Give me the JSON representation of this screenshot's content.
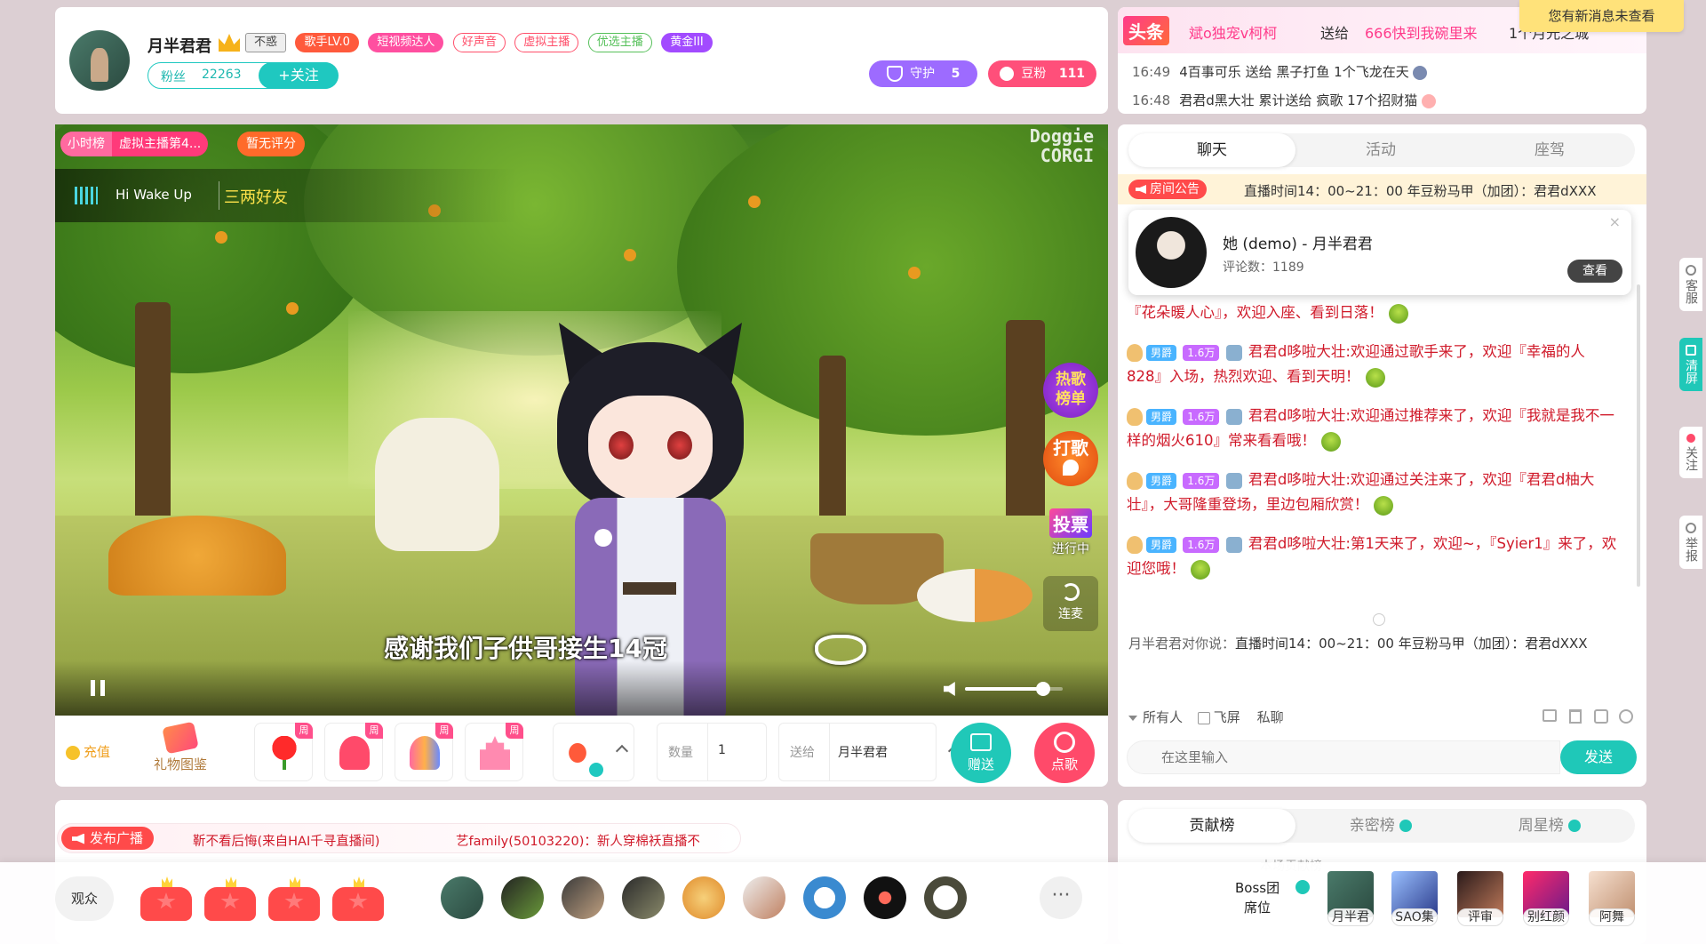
{
  "header": {
    "anchor_name": "月半君君",
    "tags": [
      "不惑",
      "歌手LV.0",
      "短视频达人",
      "好声音",
      "虚拟主播",
      "优选主播",
      "黄金III"
    ],
    "fans_label": "粉丝",
    "fans_count": "22263",
    "follow_label": "+关注",
    "guard_label": "守护",
    "guard_count": "5",
    "doufen_label": "豆粉",
    "doufen_count": "111"
  },
  "news": {
    "headline_tag": "头条",
    "headline_user": "斌o独宠v柯柯",
    "headline_action": "送给",
    "headline_target": "666快到我碗里来",
    "headline_gift": "1个月光之城",
    "notice": "您有新消息未查看",
    "items": [
      {
        "time": "16:49",
        "user": "4百事可乐",
        "action": "送给",
        "target": "黑子打鱼",
        "gift": "1个飞龙在天"
      },
      {
        "time": "16:48",
        "user": "君君d黑大壮",
        "action": "累计送给",
        "target": "疯歌",
        "gift": "17个招财猫"
      }
    ]
  },
  "video": {
    "hour_rank_label": "小时榜",
    "hour_rank_value": "虚拟主播第4...",
    "score_label": "暂无评分",
    "song_title": "Hi Wake Up",
    "song_artist": "三两好友",
    "watermark_line1": "Doggie",
    "watermark_line2": "CORGI",
    "subtitle": "感谢我们子供哥接生14冠",
    "side_buttons": {
      "hot_song_1": "热歌",
      "hot_song_2": "榜单",
      "dage_1": "打",
      "dage_2": "歌",
      "vote_1": "投票",
      "vote_2": "进行中",
      "lianmai": "连麦"
    },
    "volume_level": 0.8
  },
  "giftbar": {
    "recharge_label": "充值",
    "gift_album_label": "礼物图鉴",
    "weekly_badge": "周",
    "qty_label": "数量",
    "qty_value": "1",
    "sendto_label": "送给",
    "sendto_value": "月半君君",
    "send_gift_label": "赠送",
    "request_song_label": "点歌"
  },
  "chat": {
    "tabs": [
      "聊天",
      "活动",
      "座驾"
    ],
    "announcement_label": "房间公告",
    "announcement_text": "直播时间14：00~21：00 年豆粉马甲（加团）：君君dXXX",
    "popup_title": "她 (demo) - 月半君君",
    "popup_comments": "评论数：1189",
    "popup_view_label": "查看",
    "first_line_tail": "『花朵暖人心』，欢迎入座、看到日落！",
    "messages": [
      {
        "badge_rank": "男爵",
        "badge_fans": "1.6万",
        "user": "君君d哆啦大壮",
        "text": "欢迎通过歌手来了，欢迎『幸福的人828』入场，热烈欢迎、看到天明！"
      },
      {
        "badge_rank": "男爵",
        "badge_fans": "1.6万",
        "user": "君君d哆啦大壮",
        "text": "欢迎通过推荐来了，欢迎『我就是我不一样的烟火610』常来看看哦！"
      },
      {
        "badge_rank": "男爵",
        "badge_fans": "1.6万",
        "user": "君君d哆啦大壮",
        "text": "欢迎通过关注来了，欢迎『君君d柚大壮』，大哥隆重登场，里边包厢欣赏！"
      },
      {
        "badge_rank": "男爵",
        "badge_fans": "1.6万",
        "user": "君君d哆啦大壮",
        "text": "第1天来了，欢迎~，『Syier1』来了，欢迎您哦！"
      }
    ],
    "whisper_prefix": "月半君君对你说：",
    "whisper_text": "直播时间14：00~21：00 年豆粉马甲（加团）：君君dXXX",
    "target_all": "所有人",
    "flying_label": "飞屏",
    "private_label": "私聊",
    "input_placeholder": "在这里输入",
    "send_label": "发送"
  },
  "rank": {
    "tabs": [
      "贡献榜",
      "亲密榜",
      "周星榜"
    ],
    "sub_label": "本场贡献榜"
  },
  "broadcast": {
    "button_label": "发布广播",
    "item1": "靳不看后悔(来自HAI千寻直播间)",
    "item2": "艺family(50103220)：新人穿棉袄直播不"
  },
  "audience": {
    "label": "观众",
    "more_label": "···",
    "boss_label_1": "Boss团",
    "boss_label_2": "席位",
    "boss_members": [
      "月半君",
      "SAO集",
      "评审",
      "别红颜",
      "阿舞"
    ]
  },
  "sidebar": {
    "kefu": "客服",
    "qingping": "清屏",
    "guanzhu": "关注",
    "jubao": "举报"
  }
}
